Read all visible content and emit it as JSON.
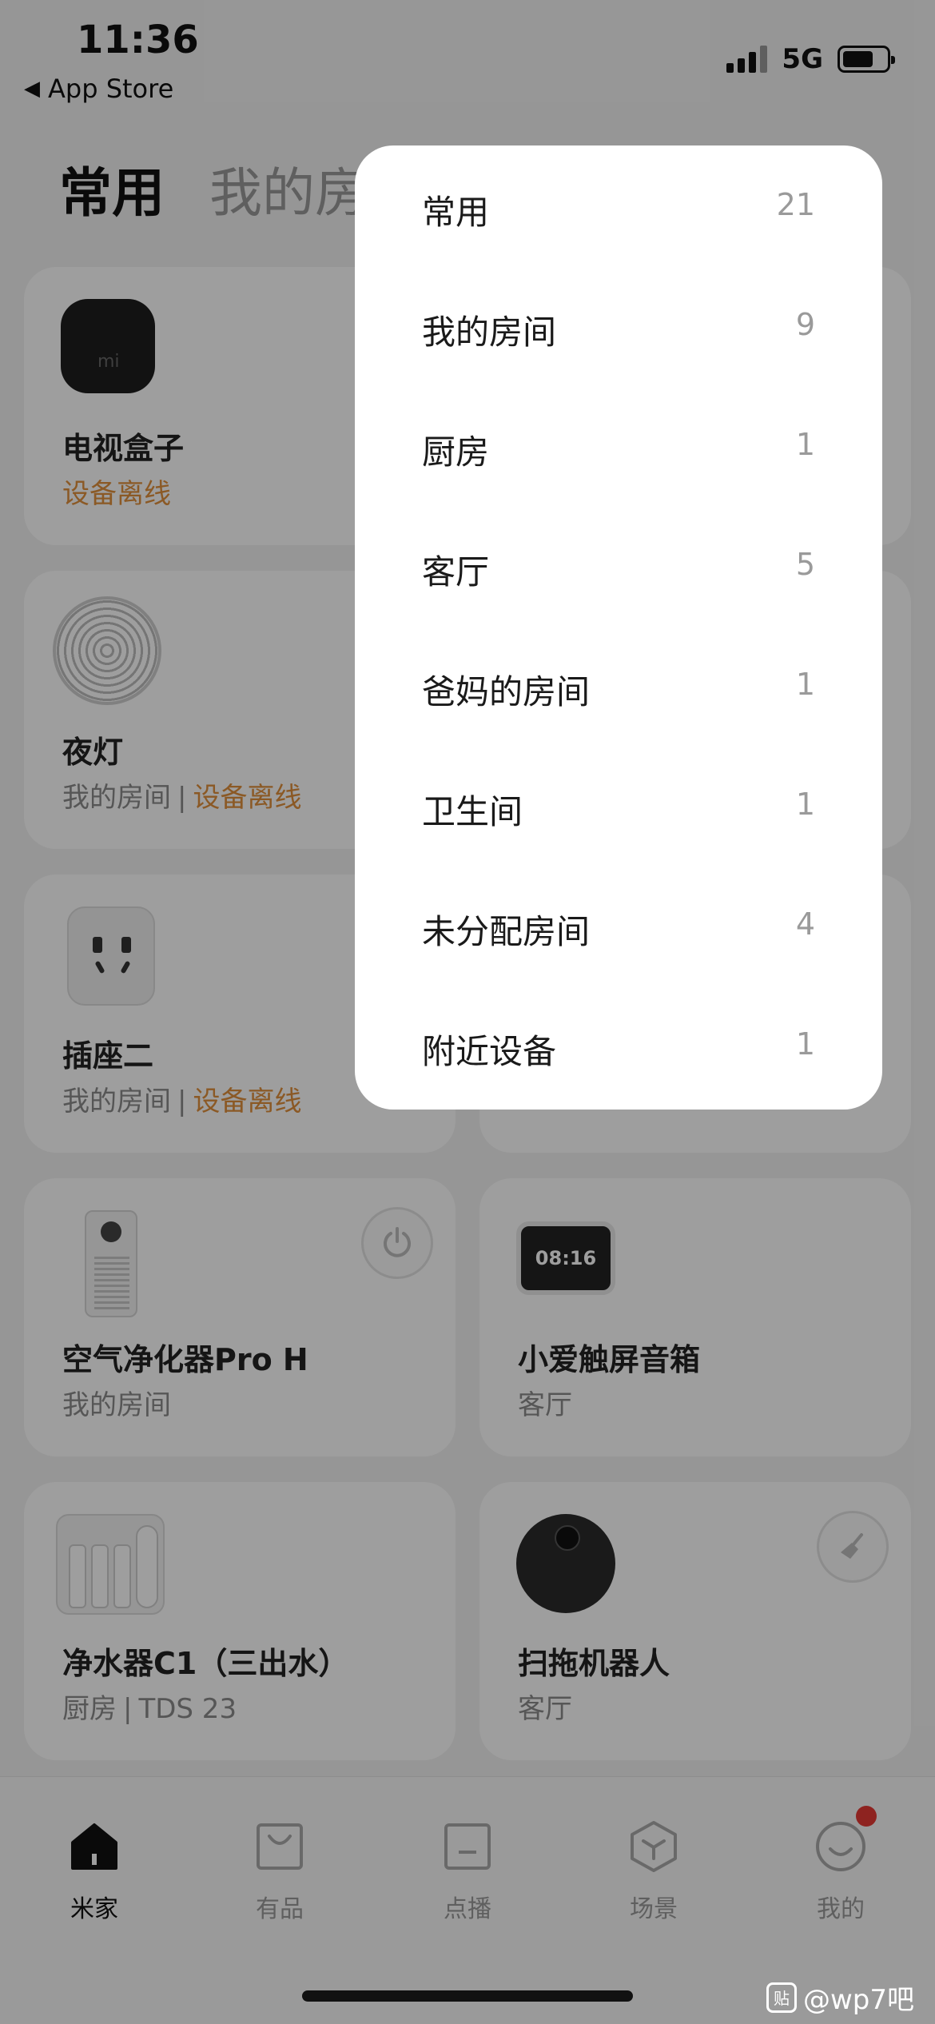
{
  "status_bar": {
    "time": "11:36",
    "back_app": "App Store",
    "network": "5G"
  },
  "header": {
    "tabs": [
      "常用",
      "我的房"
    ]
  },
  "devices": [
    {
      "name": "电视盒子",
      "room": "",
      "status": "设备离线",
      "icon": "tv-box-icon"
    },
    {
      "name": "夜灯",
      "room": "我的房间",
      "status": "设备离线",
      "icon": "night-light-icon"
    },
    {
      "name": "插座二",
      "room": "我的房间",
      "status": "设备离线",
      "icon": "socket-icon"
    },
    {
      "name": "空气净化器Pro H",
      "room": "我的房间",
      "status": "",
      "icon": "air-purifier-icon",
      "action_icon": "power-icon"
    },
    {
      "name": "小爱触屏音箱",
      "room": "客厅",
      "status": "",
      "icon": "smart-speaker-icon",
      "screen_text": "08:16"
    },
    {
      "name": "净水器C1（三出水）",
      "room": "厨房",
      "status": "TDS 23",
      "icon": "water-purifier-icon"
    },
    {
      "name": "扫拖机器人",
      "room": "客厅",
      "status": "",
      "icon": "robot-vacuum-icon",
      "action_icon": "broom-icon"
    }
  ],
  "room_menu": [
    {
      "label": "常用",
      "count": "21"
    },
    {
      "label": "我的房间",
      "count": "9"
    },
    {
      "label": "厨房",
      "count": "1"
    },
    {
      "label": "客厅",
      "count": "5"
    },
    {
      "label": "爸妈的房间",
      "count": "1"
    },
    {
      "label": "卫生间",
      "count": "1"
    },
    {
      "label": "未分配房间",
      "count": "4"
    },
    {
      "label": "附近设备",
      "count": "1"
    }
  ],
  "tabbar": [
    {
      "label": "米家",
      "icon": "home-icon"
    },
    {
      "label": "有品",
      "icon": "shopping-bag-icon"
    },
    {
      "label": "点播",
      "icon": "media-icon"
    },
    {
      "label": "场景",
      "icon": "cube-icon"
    },
    {
      "label": "我的",
      "icon": "smile-icon"
    }
  ],
  "watermark": "@wp7吧",
  "colors": {
    "offline_accent": "#e0903c",
    "badge": "#e53935"
  }
}
